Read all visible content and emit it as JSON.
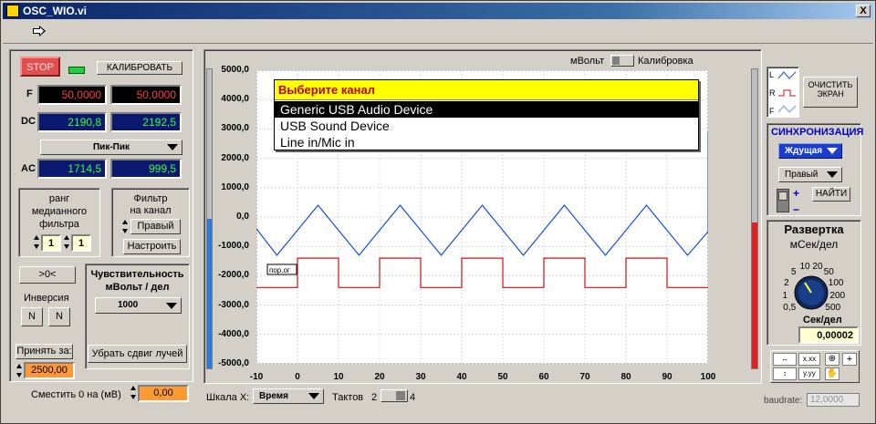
{
  "window": {
    "title": "OSC_WIO.vi",
    "close_label": "X"
  },
  "toolbar": {
    "run_icon": "run-arrow-icon"
  },
  "controls": {
    "stop_label": "STOP",
    "calibrate_label": "КАЛИБРОВАТЬ",
    "f_label": "F",
    "f_left": "50,0000",
    "f_right": "50,0000",
    "dc_label": "DC",
    "dc_left": "2190,8",
    "dc_right": "2192,5",
    "mode_select": "Пик-Пик",
    "ac_label": "AC",
    "ac_left": "1714,5",
    "ac_right": "999,5",
    "median_label_1": "ранг",
    "median_label_2": "медианного",
    "median_label_3": "фильтра",
    "median_a": "1",
    "median_b": "1",
    "filter_label_1": "Фильтр",
    "filter_label_2": "на канал",
    "filter_channel": "Правый",
    "setup_label": "Настроить",
    "zero_btn": ">0<",
    "sensitivity_1": "Чувствительность",
    "sensitivity_2": "мВольт / дел",
    "sensitivity_value": "1000",
    "inversion_label": "Инверсия",
    "inv_left": "N",
    "inv_right": "N",
    "accept_label": "Принять за:",
    "accept_value": "2500,00",
    "remove_shift_label": "Убрать сдвиг лучей",
    "shift_label": "Сместить 0 на (мВ)",
    "shift_value": "0,00"
  },
  "chart_header": {
    "unit_left": "мВольт",
    "unit_right": "Калибровка"
  },
  "channel_popup": {
    "title": "Выберите  канал",
    "options": [
      "Generic USB Audio Device",
      "USB Sound Device",
      "Line in/Mic in"
    ],
    "selected": 0
  },
  "chart_footer": {
    "scale_label": "Шкала X:",
    "scale_value": "Время",
    "tacts_label": "Тактов",
    "tacts_min": "2",
    "tacts_max": "4"
  },
  "chart_data": {
    "type": "line",
    "x_ticks": [
      "-10",
      "0",
      "10",
      "20",
      "30",
      "40",
      "50",
      "60",
      "70",
      "80",
      "90",
      "100"
    ],
    "y_ticks": [
      "5000,0",
      "4000,0",
      "3000,0",
      "2000,0",
      "1000,0",
      "0,0",
      "-1000,0",
      "-2000,0",
      "-3000,0",
      "-4000,0",
      "-5000,0"
    ],
    "xlim": [
      -10,
      100
    ],
    "ylim": [
      -5000,
      5000
    ],
    "trigger_label": "пор.ог",
    "series": [
      {
        "color": "#1a4fd6",
        "x": [
          -10,
          -5,
          5,
          15,
          25,
          35,
          45,
          55,
          65,
          75,
          85,
          95,
          100,
          100
        ],
        "y": [
          -400,
          -1300,
          400,
          -1300,
          400,
          -1300,
          400,
          -1300,
          400,
          -1300,
          400,
          -1300,
          -500,
          2900
        ]
      },
      {
        "color": "#d01010",
        "x": [
          -10,
          0,
          0,
          10,
          10,
          20,
          20,
          30,
          30,
          40,
          40,
          50,
          50,
          60,
          60,
          70,
          70,
          80,
          80,
          90,
          90,
          100
        ],
        "y": [
          -2400,
          -2400,
          -1400,
          -1400,
          -2400,
          -2400,
          -1400,
          -1400,
          -2400,
          -2400,
          -1400,
          -1400,
          -2400,
          -2400,
          -1400,
          -1400,
          -2400,
          -2400,
          -1400,
          -1400,
          -2400,
          -2400
        ]
      }
    ]
  },
  "right_panel": {
    "legend_l": "L",
    "legend_r": "R",
    "legend_f": "F",
    "clear_1": "ОЧИСТИТЬ",
    "clear_2": "ЭКРАН",
    "sync_label": "СИНХРОНИЗАЦИЯ",
    "sync_mode": "Ждущая",
    "sync_channel": "Правый",
    "find_label": "НАЙТИ",
    "plus": "+",
    "minus": "−",
    "sweep_label": "Развертка",
    "sweep_unit": "мСек/дел",
    "knob_ticks": [
      "0,5",
      "1",
      "2",
      "5",
      "10",
      "20",
      "50",
      "100",
      "200",
      "500"
    ],
    "sec_label": "Сек/дел",
    "sec_value": "0,00002",
    "baud_label": "baudrate:",
    "baud_value": "12,0000"
  },
  "colors": {
    "blue_series": "#1a4fd6",
    "red_series": "#d01010",
    "popup_title_bg": "#ffff00",
    "popup_selected_bg": "#000000"
  }
}
